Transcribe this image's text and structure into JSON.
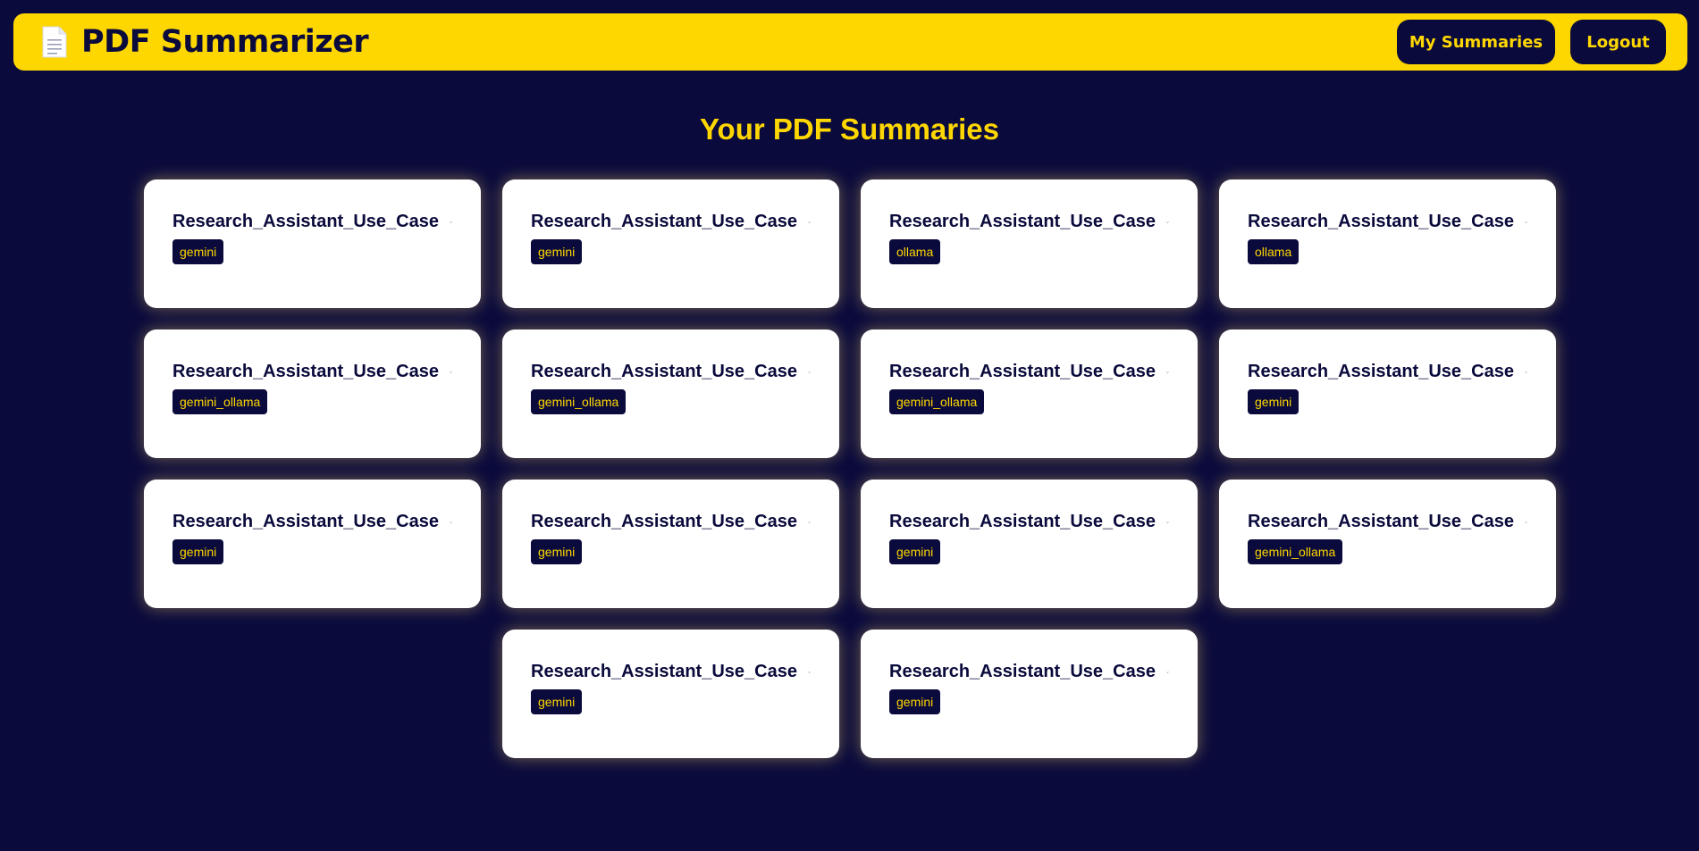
{
  "navbar": {
    "icon": "document-icon",
    "title": "PDF Summarizer",
    "my_summaries_label": "My Summaries",
    "logout_label": "Logout"
  },
  "page_title": "Your PDF Summaries",
  "colors": {
    "background": "#0a0a3c",
    "accent": "#ffd700",
    "card": "#ffffff"
  },
  "summaries": [
    {
      "title": "Research_Assistant_Use_Case",
      "model": "gemini"
    },
    {
      "title": "Research_Assistant_Use_Case",
      "model": "gemini"
    },
    {
      "title": "Research_Assistant_Use_Case",
      "model": "ollama"
    },
    {
      "title": "Research_Assistant_Use_Case",
      "model": "ollama"
    },
    {
      "title": "Research_Assistant_Use_Case",
      "model": "gemini_ollama"
    },
    {
      "title": "Research_Assistant_Use_Case",
      "model": "gemini_ollama"
    },
    {
      "title": "Research_Assistant_Use_Case",
      "model": "gemini_ollama"
    },
    {
      "title": "Research_Assistant_Use_Case",
      "model": "gemini"
    },
    {
      "title": "Research_Assistant_Use_Case",
      "model": "gemini"
    },
    {
      "title": "Research_Assistant_Use_Case",
      "model": "gemini"
    },
    {
      "title": "Research_Assistant_Use_Case",
      "model": "gemini"
    },
    {
      "title": "Research_Assistant_Use_Case",
      "model": "gemini_ollama"
    },
    {
      "title": "Research_Assistant_Use_Case",
      "model": "gemini"
    },
    {
      "title": "Research_Assistant_Use_Case",
      "model": "gemini"
    }
  ]
}
